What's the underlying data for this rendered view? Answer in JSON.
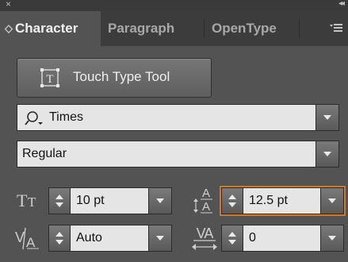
{
  "window": {
    "close_glyph": "×",
    "collapse_glyph": "◂◂"
  },
  "tabs": [
    {
      "label": "Character",
      "prefix": "◇",
      "active": true
    },
    {
      "label": "Paragraph",
      "active": false
    },
    {
      "label": "OpenType",
      "active": false
    }
  ],
  "panel_menu_icon": "hamburger-menu-icon",
  "touch_type_tool": {
    "label": "Touch Type Tool",
    "icon": "touch-type-icon"
  },
  "font_family": {
    "value": "Times",
    "icon": "search-dropdown-icon"
  },
  "font_style": {
    "value": "Regular"
  },
  "font_size": {
    "value": "10 pt",
    "icon": "font-size-icon"
  },
  "leading": {
    "value": "12.5 pt",
    "icon": "leading-icon",
    "highlighted": true
  },
  "kerning": {
    "value": "Auto",
    "icon": "kerning-icon"
  },
  "tracking": {
    "value": "0",
    "icon": "tracking-icon"
  },
  "colors": {
    "panel": "#535353",
    "tab_bar": "#3c3c3c",
    "field": "#e5e5e5",
    "focus": "#cc7a32"
  }
}
